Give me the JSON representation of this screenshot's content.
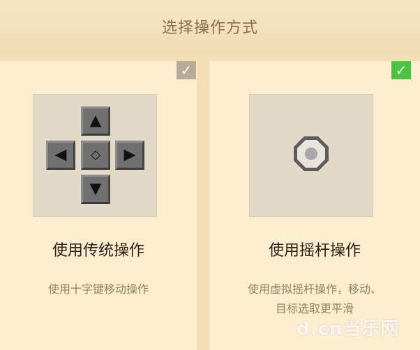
{
  "header": {
    "title": "选择操作方式"
  },
  "options": [
    {
      "title": "使用传统操作",
      "desc": "使用十字键移动操作",
      "dpad": {
        "up": "▲",
        "down": "▼",
        "left": "◀",
        "right": "▶",
        "center": "◇"
      },
      "selected_indicator": "✓"
    },
    {
      "title": "使用摇杆操作",
      "desc_line1": "使用虚拟摇杆操作，移动、",
      "desc_line2": "目标选取更平滑",
      "selected_indicator": "✓"
    }
  ],
  "watermark": "d.cn当乐网",
  "colors": {
    "background": "#f3dfb3",
    "panel": "#fdeed0",
    "check_selected": "#4bc240",
    "check_unselected": "#b7aa98",
    "title_text": "#8a6e4c",
    "desc_text": "#96805f"
  },
  "icons": [
    "check-icon",
    "dpad-icon",
    "joystick-icon"
  ]
}
